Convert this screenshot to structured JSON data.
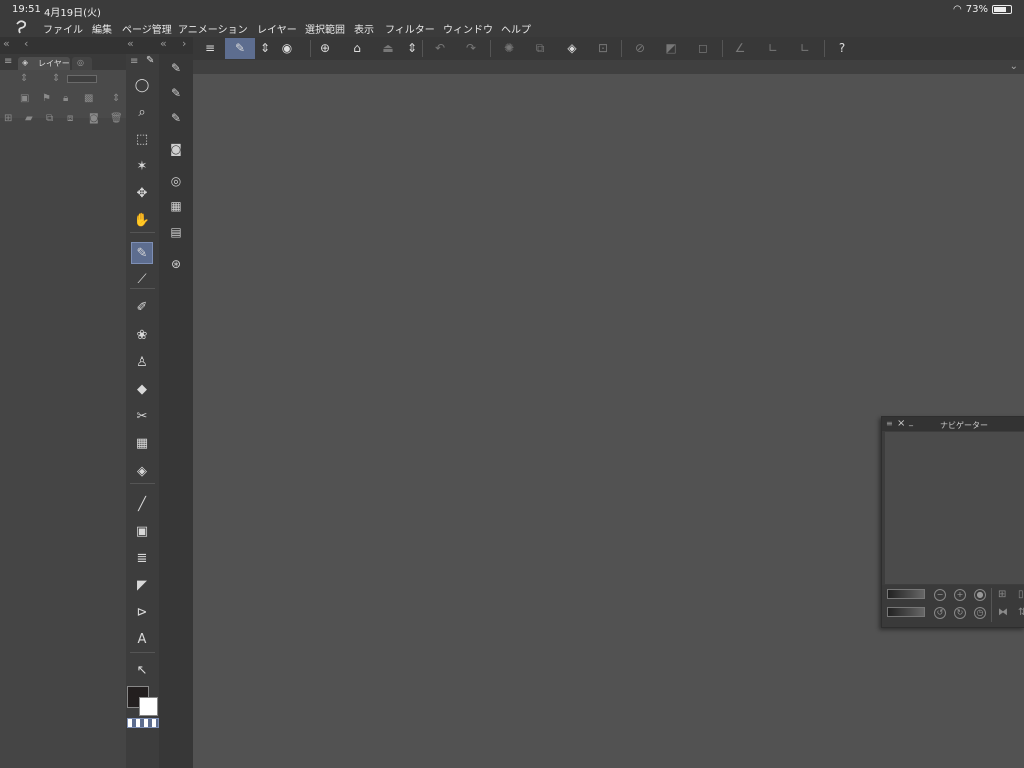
{
  "status": {
    "time": "19:51",
    "date": "4月19日(火)",
    "battery": "73%",
    "battery_level": 0.73
  },
  "menu": [
    "ファイル",
    "編集",
    "ページ管理",
    "アニメーション",
    "レイヤー",
    "選択範囲",
    "表示",
    "フィルター",
    "ウィンドウ",
    "ヘルプ"
  ],
  "panel_strip": {
    "collapse_left": "«",
    "back": "‹",
    "collapse_mid": "«",
    "collapse_right": "«",
    "forward": "›"
  },
  "layer_panel": {
    "tab_label": "レイヤー"
  },
  "tools": [
    {
      "icon": "lasso-icon",
      "glyph": "◯"
    },
    {
      "icon": "zoom-icon",
      "glyph": "⌕"
    },
    {
      "icon": "object-select-icon",
      "glyph": "⬚"
    },
    {
      "icon": "magic-wand-icon",
      "glyph": "✶"
    },
    {
      "icon": "move-icon",
      "glyph": "✥"
    },
    {
      "icon": "hand-icon",
      "glyph": "✋"
    },
    {
      "icon": "pen-icon",
      "glyph": "✎",
      "selected": true
    },
    {
      "icon": "eyedropper-icon",
      "glyph": "⟋"
    },
    {
      "icon": "pencil-icon",
      "glyph": "✐"
    },
    {
      "icon": "decoration-icon",
      "glyph": "❀"
    },
    {
      "icon": "airbrush-icon",
      "glyph": "♙"
    },
    {
      "icon": "eraser-icon",
      "glyph": "◆"
    },
    {
      "icon": "blend-icon",
      "glyph": "✂"
    },
    {
      "icon": "frame-icon",
      "glyph": "▦"
    },
    {
      "icon": "fill-icon",
      "glyph": "◈"
    },
    {
      "icon": "line-icon",
      "glyph": "╱"
    },
    {
      "icon": "gradient-icon",
      "glyph": "▣"
    },
    {
      "icon": "ruler-icon",
      "glyph": "≣"
    },
    {
      "icon": "figure-icon",
      "glyph": "◤"
    },
    {
      "icon": "balloon-icon",
      "glyph": "⊳"
    },
    {
      "icon": "text-icon",
      "glyph": "A"
    },
    {
      "icon": "correct-line-icon",
      "glyph": "↖"
    }
  ],
  "subtools": [
    {
      "icon": "pen-sub-1-icon",
      "glyph": "✎"
    },
    {
      "icon": "pen-sub-2-icon",
      "glyph": "✎"
    },
    {
      "icon": "pen-sub-3-icon",
      "glyph": "✎"
    },
    {
      "icon": "camera-icon",
      "glyph": "◙"
    },
    {
      "icon": "color-circle-icon",
      "glyph": "◎"
    },
    {
      "icon": "material-icon",
      "glyph": "▦"
    },
    {
      "icon": "film-icon",
      "glyph": "▤"
    },
    {
      "icon": "search-icon",
      "glyph": "⊛"
    }
  ],
  "colors": {
    "main": "#231f1f",
    "sub": "#ffffff",
    "accent": "#5d6d8f",
    "bg": "#525252"
  },
  "toolbar": [
    {
      "icon": "menu-icon",
      "glyph": "≡",
      "dim": false
    },
    {
      "icon": "pen-settings-icon",
      "glyph": "✎",
      "dim": false,
      "selected": true
    },
    {
      "icon": "updown-icon",
      "glyph": "⇕",
      "dim": false
    },
    {
      "icon": "stabilizer-icon",
      "glyph": "◉",
      "dim": false
    },
    {
      "icon": "new-file-icon",
      "glyph": "⊕",
      "dim": false
    },
    {
      "icon": "open-folder-icon",
      "glyph": "⌂",
      "dim": false
    },
    {
      "icon": "save-icon",
      "glyph": "⏏",
      "dim": true
    },
    {
      "icon": "updown-2-icon",
      "glyph": "⇕",
      "dim": false
    },
    {
      "icon": "undo-icon",
      "glyph": "↶",
      "dim": true
    },
    {
      "icon": "redo-icon",
      "glyph": "↷",
      "dim": true
    },
    {
      "icon": "clear-icon",
      "glyph": "✺",
      "dim": true
    },
    {
      "icon": "clear-outside-icon",
      "glyph": "⧉",
      "dim": true
    },
    {
      "icon": "fill-selection-icon",
      "glyph": "◈",
      "dim": false
    },
    {
      "icon": "transform-icon",
      "glyph": "⊡",
      "dim": true
    },
    {
      "icon": "deselect-icon",
      "glyph": "⊘",
      "dim": true
    },
    {
      "icon": "invert-selection-icon",
      "glyph": "◩",
      "dim": true
    },
    {
      "icon": "shrink-selection-icon",
      "glyph": "◻",
      "dim": true
    },
    {
      "icon": "snap-ruler-icon",
      "glyph": "∠",
      "dim": true
    },
    {
      "icon": "snap-special-icon",
      "glyph": "∟",
      "dim": true
    },
    {
      "icon": "snap-grid-icon",
      "glyph": "∟",
      "dim": true
    },
    {
      "icon": "help-icon",
      "glyph": "?",
      "dim": false
    }
  ],
  "navigator": {
    "title": "ナビゲーター"
  }
}
